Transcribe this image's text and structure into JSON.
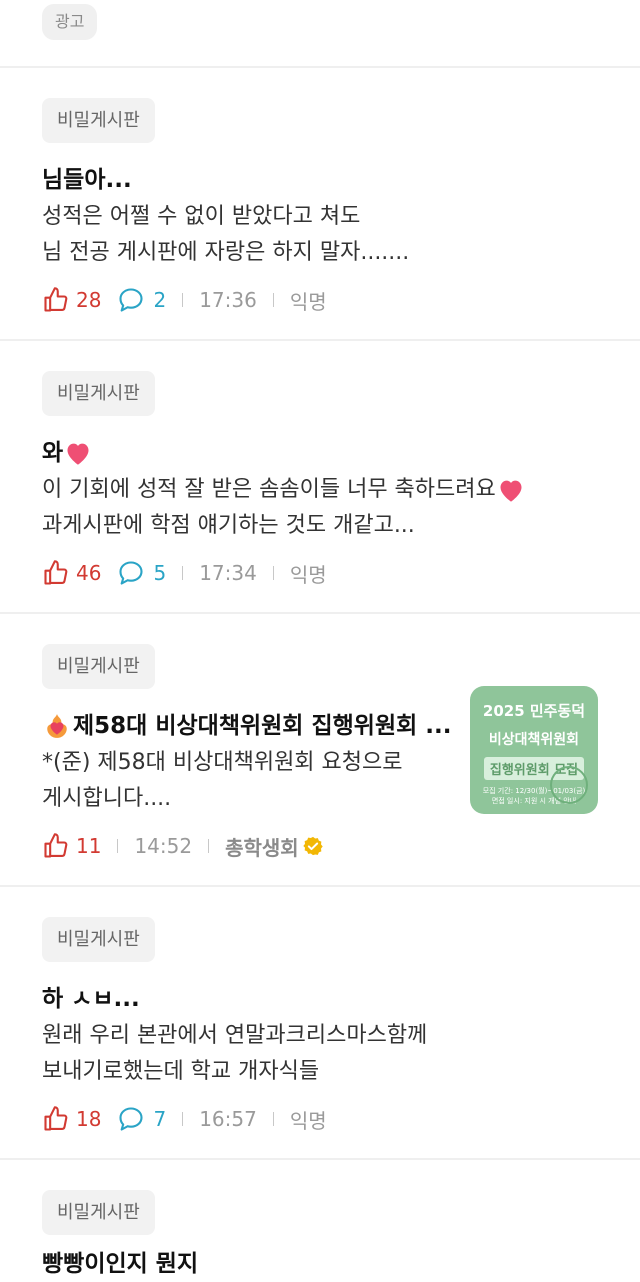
{
  "ad": {
    "label": "광고"
  },
  "posts": [
    {
      "board": "비밀게시판",
      "title": "님들아...",
      "body": [
        "성적은 어쩔 수 없이 받았다고 쳐도",
        "님 전공 게시판에 자랑은 하지 말자......."
      ],
      "likes": "28",
      "comments": "2",
      "time": "17:36",
      "author": "익명"
    },
    {
      "board": "비밀게시판",
      "title": "와",
      "body_line1": "이 기회에 성적 잘 받은 솜솜이들 너무 축하드려요",
      "body_line2": "과게시판에 학점 얘기하는 것도 개같고...",
      "likes": "46",
      "comments": "5",
      "time": "17:34",
      "author": "익명"
    },
    {
      "board": "비밀게시판",
      "title": "제58대 비상대책위원회 집행위원회 ...",
      "body": [
        "*(준) 제58대 비상대책위원회 요청으로",
        "게시합니다...."
      ],
      "likes": "11",
      "time": "14:52",
      "author": "총학생회",
      "thumbnail": {
        "line1": "2025 민주동덕",
        "line2": "비상대책위원회",
        "line3": "집행위원회 모집",
        "line4": "모집 기간: 12/30(월)~01/03(금)",
        "line5": "면접 일시: 지원 시 개별 안내"
      }
    },
    {
      "board": "비밀게시판",
      "title": "하 ㅅㅂ...",
      "body": [
        "원래 우리 본관에서 연말과크리스마스함께",
        "보내기로했는데 학교 개자식들"
      ],
      "likes": "18",
      "comments": "7",
      "time": "16:57",
      "author": "익명"
    },
    {
      "board": "비밀게시판",
      "title": "빵빵이인지 뭔지"
    }
  ],
  "colors": {
    "like": "#d23a32",
    "comment": "#2aa4c6",
    "verified": "#f2b705",
    "heart": "#ef4f74"
  },
  "icons": {
    "like": "thumbs-up-icon",
    "comment": "speech-bubble-icon",
    "verified": "verified-badge-icon",
    "heart": "heart-emoji-icon"
  }
}
